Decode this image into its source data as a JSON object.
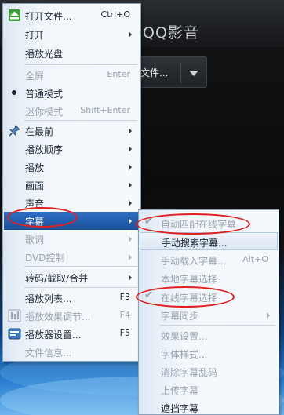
{
  "player": {
    "logo_text": "QQ影音",
    "open_button_label": "文件..."
  },
  "main_menu": {
    "items": [
      {
        "label": "打开文件...",
        "shortcut": "Ctrl+O",
        "icon": "eject-icon"
      },
      {
        "label": "打开",
        "submenu": true
      },
      {
        "label": "播放光盘"
      },
      {
        "label": "全屏",
        "shortcut": "Enter",
        "disabled": true
      },
      {
        "label": "普通模式",
        "checked": true
      },
      {
        "label": "迷你模式",
        "shortcut": "Shift+Enter",
        "disabled": true
      },
      {
        "label": "在最前",
        "submenu": true,
        "icon": "pin-icon"
      },
      {
        "label": "播放顺序",
        "submenu": true
      },
      {
        "label": "播放",
        "submenu": true
      },
      {
        "label": "画面",
        "submenu": true
      },
      {
        "label": "声音",
        "submenu": true
      },
      {
        "label": "字幕",
        "submenu": true,
        "highlighted": true
      },
      {
        "label": "歌词",
        "submenu": true,
        "disabled": true
      },
      {
        "label": "DVD控制",
        "submenu": true,
        "disabled": true
      },
      {
        "label": "转码/截取/合并",
        "submenu": true
      },
      {
        "label": "播放列表...",
        "shortcut": "F3"
      },
      {
        "label": "播放效果调节...",
        "shortcut": "F4",
        "disabled": true,
        "icon": "equalizer-icon"
      },
      {
        "label": "播放器设置...",
        "shortcut": "F5",
        "icon": "settings-icon"
      },
      {
        "label": "文件信息...",
        "disabled": true
      }
    ]
  },
  "subtitle_menu": {
    "items": [
      {
        "label": "自动匹配在线字幕",
        "disabled": true,
        "checked": true
      },
      {
        "label": "手动搜索字幕..."
      },
      {
        "label": "手动载入字幕...",
        "shortcut": "Alt+O",
        "disabled": true
      },
      {
        "label": "本地字幕选择",
        "disabled": true
      },
      {
        "label": "在线字幕选择",
        "disabled": true,
        "checked": true
      },
      {
        "label": "字幕同步",
        "submenu": true,
        "disabled": true
      },
      {
        "label": "效果设置...",
        "disabled": true
      },
      {
        "label": "字体样式...",
        "disabled": true
      },
      {
        "label": "消除字幕乱码",
        "disabled": true
      },
      {
        "label": "上传字幕",
        "disabled": true
      },
      {
        "label": "遮挡字幕"
      }
    ]
  },
  "colors": {
    "highlight": "#1a4f9a",
    "annotation": "#e02020"
  }
}
